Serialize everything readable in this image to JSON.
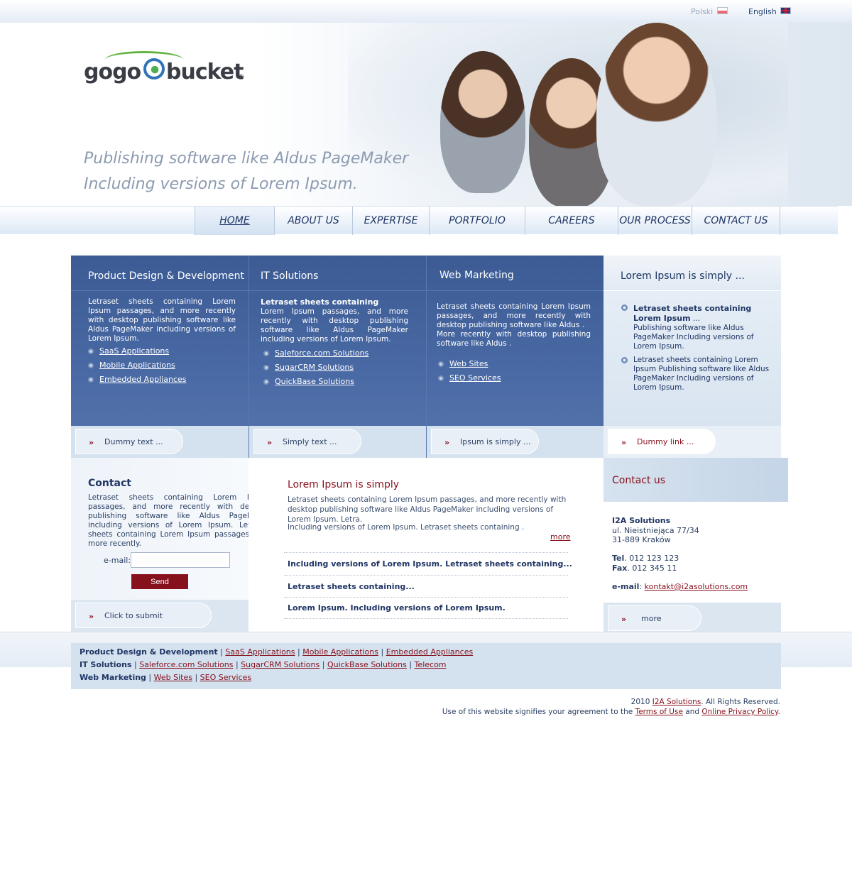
{
  "languages": [
    {
      "label": "Polski"
    },
    {
      "label": "English"
    }
  ],
  "logo": {
    "left": "gogo",
    "right": "bucket",
    "reg": "®"
  },
  "tagline": [
    "Publishing software like Aldus PageMaker",
    "Including versions of Lorem Ipsum."
  ],
  "nav": [
    "HOME",
    "ABOUT US",
    "EXPERTISE",
    "PORTFOLIO",
    "CAREERS",
    "OUR PROCESS",
    "CONTACT US"
  ],
  "features": [
    {
      "title": "Product Design & Development",
      "text": "Letraset sheets containing Lorem Ipsum passages, and more recently with desktop publishing software like Aldus PageMaker including versions of Lorem Ipsum.",
      "links": [
        "SaaS Applications",
        "Mobile Applications",
        "Embedded Appliances"
      ],
      "footer": "Dummy text ..."
    },
    {
      "title": "IT Solutions",
      "heading": "Letraset sheets containing",
      "text": "Lorem Ipsum passages, and more recently with desktop publishing software like Aldus PageMaker including versions of Lorem Ipsum.",
      "links": [
        "Saleforce.com Solutions",
        "SugarCRM Solutions",
        "QuickBase Solutions"
      ],
      "footer": "Simply text ..."
    },
    {
      "title": "Web  Marketing",
      "text": "Letraset sheets containing Lorem Ipsum passages, and more recently with desktop publishing software like Aldus .",
      "text2": "More recently with desktop publishing software like Aldus .",
      "links": [
        "Web Sites",
        "SEO Services"
      ],
      "footer": "Ipsum is simply ..."
    },
    {
      "title": "Lorem Ipsum is simply ...",
      "item1_title": "Letraset sheets containing Lorem Ipsum",
      "item1_suffix": "...",
      "item1_text": "Publishing software like Aldus PageMaker Including versions of Lorem Ipsum.",
      "item2_text": "Letraset sheets containing Lorem Ipsum Publishing software like Aldus PageMaker Including versions of Lorem Ipsum.",
      "footer": "Dummy link ..."
    }
  ],
  "contact": {
    "title": "Contact",
    "text": "Letraset sheets containing Lorem Ipsum passages, and more recently with desktop publishing software like Aldus PageMaker including versions of Lorem Ipsum. Letraset sheets containing Lorem Ipsum passages, and more recently.",
    "email_label": "e-mail:",
    "send": "Send",
    "footer": "Click to submit"
  },
  "news": {
    "title": "Lorem Ipsum is simply",
    "text1": "Letraset sheets containing Lorem Ipsum passages, and more recently with desktop publishing software like Aldus PageMaker including versions of Lorem Ipsum. Letra.",
    "text2": "Including versions of Lorem Ipsum. Letraset sheets containing .",
    "more": "more",
    "items": [
      "Including versions of Lorem Ipsum. Letraset sheets containing...",
      "Letraset sheets containing...",
      "Lorem Ipsum. Including versions of Lorem Ipsum."
    ]
  },
  "contact_us": {
    "title": "Contact us",
    "company": "I2A Solutions",
    "street": "ul. Nieistniejąca 77/34",
    "city": "31-889 Kraków",
    "tel_label": "Tel",
    "tel": ". 012 123 123",
    "fax_label": "Fax",
    "fax": ". 012 345 11",
    "email_label": "e-mail",
    "email_sep": ": ",
    "email": "kontakt@i2asolutions.com",
    "footer": "more"
  },
  "sitemap": [
    {
      "title": "Product Design & Development",
      "links": [
        "SaaS Applications",
        "Mobile Applications",
        "Embedded Appliances"
      ]
    },
    {
      "title": "IT Solutions",
      "links": [
        "Saleforce.com Solutions",
        "SugarCRM Solutions",
        "QuickBase Solutions",
        "Telecom"
      ]
    },
    {
      "title": "Web  Marketing",
      "links": [
        "Web Sites",
        "SEO Services"
      ]
    }
  ],
  "copyright": {
    "year": "2010",
    "company": "I2A Solutions",
    "rights": ". All Rights Reserved.",
    "agreement": "Use of this website signifies your agreement to the",
    "terms": "Terms of Use",
    "and": "and",
    "privacy": "Online Privacy Policy",
    "end": "."
  },
  "colors": {
    "primary_blue": "#3c5b94",
    "accent_red": "#86101c",
    "light_blue": "#d4e1ee"
  }
}
